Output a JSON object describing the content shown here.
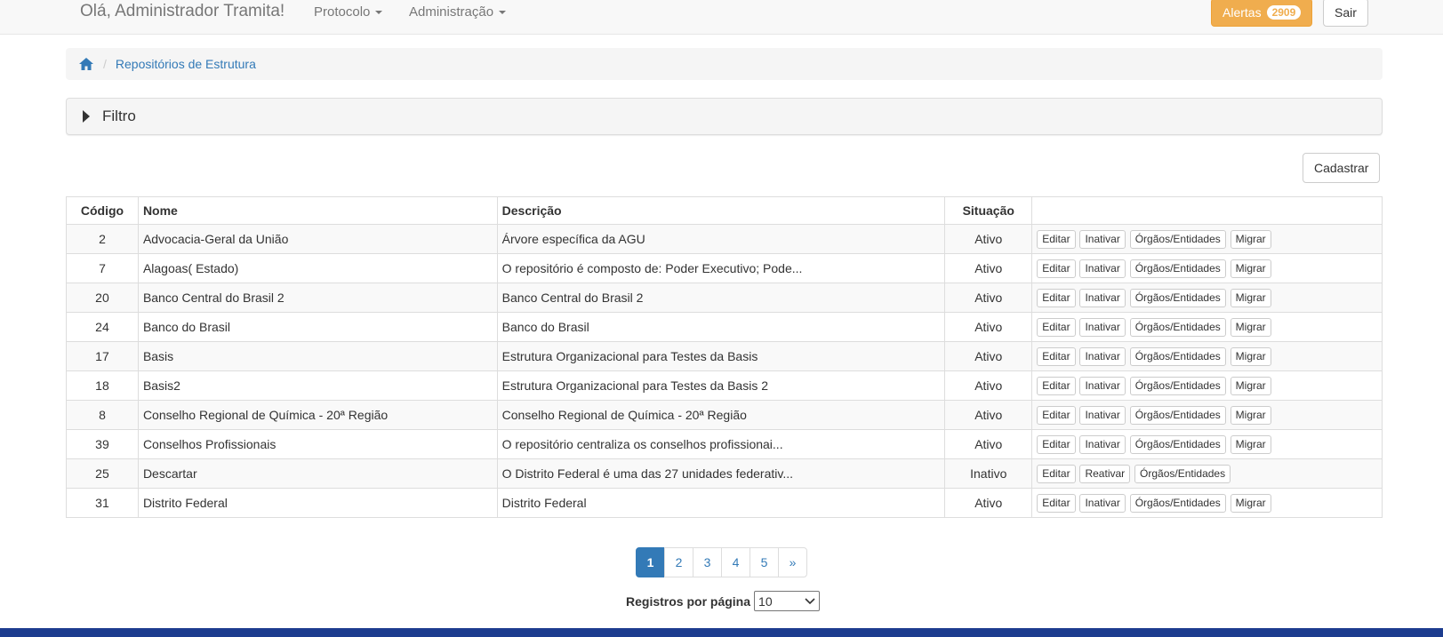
{
  "header": {
    "greeting": "Olá, Administrador Tramita!",
    "menu_protocolo": "Protocolo",
    "menu_administracao": "Administração",
    "alerts_label": "Alertas",
    "alerts_count": "2909",
    "logout_label": "Sair"
  },
  "breadcrumb": {
    "current": "Repositórios de Estrutura"
  },
  "filter": {
    "title": "Filtro"
  },
  "actions": {
    "create_label": "Cadastrar"
  },
  "table": {
    "headers": {
      "code": "Código",
      "name": "Nome",
      "description": "Descrição",
      "status": "Situação"
    },
    "rows": [
      {
        "code": "2",
        "name": "Advocacia-Geral da União",
        "description": "Árvore específica da AGU",
        "status": "Ativo",
        "edit": "Editar",
        "toggle": "Inativar",
        "orgs": "Órgãos/Entidades",
        "migrate": "Migrar"
      },
      {
        "code": "7",
        "name": "Alagoas( Estado)",
        "description": "O repositório é composto de: Poder Executivo; Pode...",
        "status": "Ativo",
        "edit": "Editar",
        "toggle": "Inativar",
        "orgs": "Órgãos/Entidades",
        "migrate": "Migrar"
      },
      {
        "code": "20",
        "name": "Banco Central do Brasil 2",
        "description": "Banco Central do Brasil 2",
        "status": "Ativo",
        "edit": "Editar",
        "toggle": "Inativar",
        "orgs": "Órgãos/Entidades",
        "migrate": "Migrar"
      },
      {
        "code": "24",
        "name": "Banco do Brasil",
        "description": "Banco do Brasil",
        "status": "Ativo",
        "edit": "Editar",
        "toggle": "Inativar",
        "orgs": "Órgãos/Entidades",
        "migrate": "Migrar"
      },
      {
        "code": "17",
        "name": "Basis",
        "description": "Estrutura Organizacional para Testes da Basis",
        "status": "Ativo",
        "edit": "Editar",
        "toggle": "Inativar",
        "orgs": "Órgãos/Entidades",
        "migrate": "Migrar"
      },
      {
        "code": "18",
        "name": "Basis2",
        "description": "Estrutura Organizacional para Testes da Basis 2",
        "status": "Ativo",
        "edit": "Editar",
        "toggle": "Inativar",
        "orgs": "Órgãos/Entidades",
        "migrate": "Migrar"
      },
      {
        "code": "8",
        "name": "Conselho Regional de Química - 20ª Região",
        "description": "Conselho Regional de Química - 20ª Região",
        "status": "Ativo",
        "edit": "Editar",
        "toggle": "Inativar",
        "orgs": "Órgãos/Entidades",
        "migrate": "Migrar"
      },
      {
        "code": "39",
        "name": "Conselhos Profissionais",
        "description": "O repositório centraliza os conselhos profissionai...",
        "status": "Ativo",
        "edit": "Editar",
        "toggle": "Inativar",
        "orgs": "Órgãos/Entidades",
        "migrate": "Migrar"
      },
      {
        "code": "25",
        "name": "Descartar",
        "description": "O Distrito Federal é uma das 27 unidades federativ...",
        "status": "Inativo",
        "edit": "Editar",
        "toggle": "Reativar",
        "orgs": "Órgãos/Entidades",
        "migrate": null
      },
      {
        "code": "31",
        "name": "Distrito Federal",
        "description": "Distrito Federal",
        "status": "Ativo",
        "edit": "Editar",
        "toggle": "Inativar",
        "orgs": "Órgãos/Entidades",
        "migrate": "Migrar"
      }
    ]
  },
  "pagination": {
    "pages": [
      "1",
      "2",
      "3",
      "4",
      "5"
    ],
    "current": "1",
    "next": "»"
  },
  "page_size": {
    "label": "Registros por página",
    "value": "10"
  },
  "colors": {
    "primary": "#337ab7",
    "warning": "#f0ad4e",
    "footer": "#1d3c8f"
  },
  "icons": {
    "home": "home-icon",
    "filter_toggle": "caret-right-icon",
    "dropdown": "caret-down-icon"
  }
}
